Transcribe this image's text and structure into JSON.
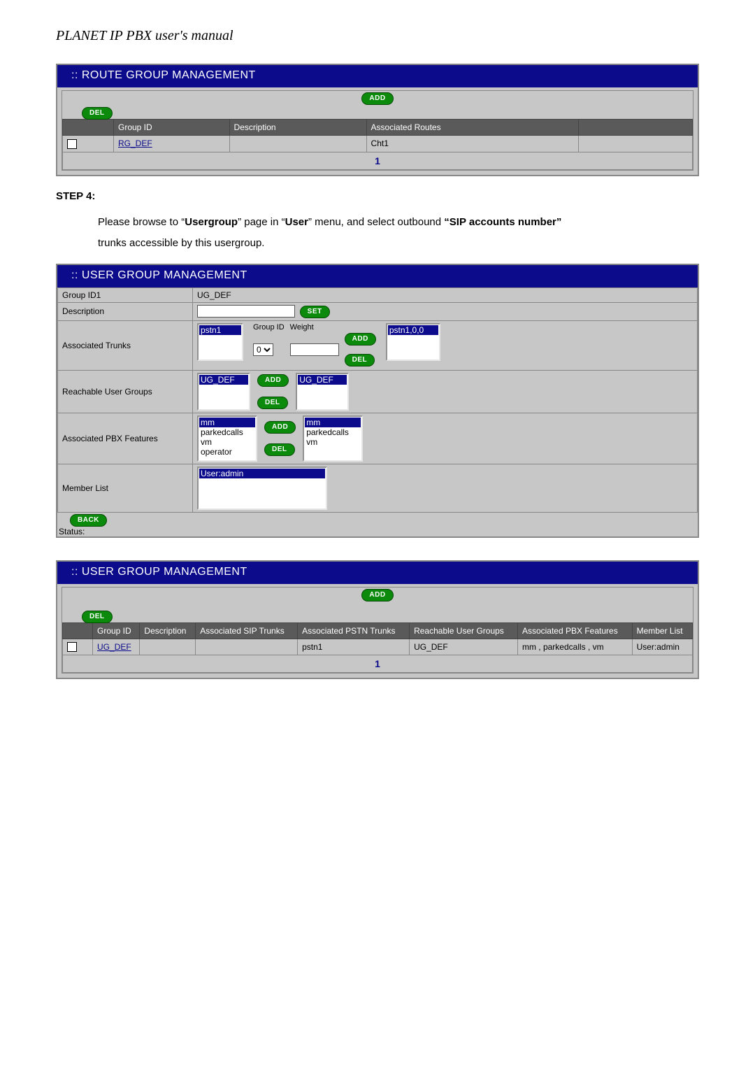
{
  "doc": {
    "title": "PLANET IP PBX user's manual",
    "step_label": "STEP 4:",
    "step_text_1": "Please browse to “",
    "step_text_2": "Usergroup",
    "step_text_3": "” page in “",
    "step_text_4": "User",
    "step_text_5": "” menu, and select outbound ",
    "step_text_6": "“SIP accounts number”",
    "step_text_7": " trunks accessible by this usergroup."
  },
  "buttons": {
    "add": "ADD",
    "del": "DEL",
    "set": "SET",
    "back": "BACK"
  },
  "panel1": {
    "title": ":: ROUTE GROUP MANAGEMENT",
    "cols": {
      "group_id": "Group ID",
      "description": "Description",
      "assoc_routes": "Associated Routes"
    },
    "row": {
      "group_id": "RG_DEF",
      "description": "",
      "assoc_routes": "Cht1"
    },
    "page": "1"
  },
  "panel2": {
    "title": ":: USER GROUP MANAGEMENT",
    "labels": {
      "group_id": "Group ID1",
      "description": "Description",
      "assoc_trunks": "Associated Trunks",
      "reachable_groups": "Reachable User Groups",
      "assoc_pbx": "Associated PBX Features",
      "member_list": "Member List",
      "status": "Status:",
      "group_id_col": "Group ID",
      "weight_col": "Weight"
    },
    "values": {
      "group_id": "UG_DEF",
      "description": "",
      "trunk_left": "pstn1",
      "trunk_dd": "0",
      "trunk_weight": "",
      "trunk_right": "pstn1,0,0",
      "rug_left": "UG_DEF",
      "rug_right": "UG_DEF",
      "pbx_left": [
        "mm",
        "parkedcalls",
        "vm",
        "operator"
      ],
      "pbx_right": [
        "mm",
        "parkedcalls",
        "vm"
      ],
      "member_list": "User:admin"
    }
  },
  "panel3": {
    "title": ":: USER GROUP MANAGEMENT",
    "cols": {
      "group_id": "Group ID",
      "description": "Description",
      "sip_trunks": "Associated SIP Trunks",
      "pstn_trunks": "Associated PSTN Trunks",
      "reachable": "Reachable User Groups",
      "pbx": "Associated PBX Features",
      "members": "Member List"
    },
    "row": {
      "group_id": "UG_DEF",
      "description": "",
      "sip_trunks": "",
      "pstn_trunks": "pstn1",
      "reachable": "UG_DEF",
      "pbx": "mm , parkedcalls , vm",
      "members": "User:admin"
    },
    "page": "1"
  }
}
